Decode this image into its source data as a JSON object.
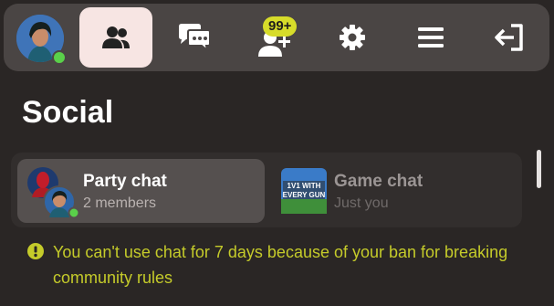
{
  "topbar": {
    "avatar_icon": "user-avatar",
    "status": "online",
    "nav": [
      {
        "icon": "friends-icon",
        "active": true
      },
      {
        "icon": "chat-bubbles-icon",
        "active": false
      },
      {
        "icon": "friend-requests-icon",
        "badge": "99+",
        "active": false
      },
      {
        "icon": "gear-icon",
        "active": false
      },
      {
        "icon": "menu-icon",
        "active": false
      },
      {
        "icon": "exit-icon",
        "active": false
      }
    ]
  },
  "page_title": "Social",
  "chats": [
    {
      "title": "Party chat",
      "subtitle": "2 members",
      "selected": true
    },
    {
      "title": "Game chat",
      "subtitle": "Just you",
      "selected": false,
      "thumbnail_text": "1V1 WITH EVERY GUN"
    }
  ],
  "warning": {
    "icon": "exclamation-icon",
    "text": "You can't use chat for 7 days because of your ban for breaking community rules"
  },
  "colors": {
    "background": "#2a2625",
    "topbar": "#4a4544",
    "active_tab": "#f7e5e3",
    "badge": "#d7dc2a",
    "warning": "#c5cb2a",
    "online": "#5ad04a"
  }
}
